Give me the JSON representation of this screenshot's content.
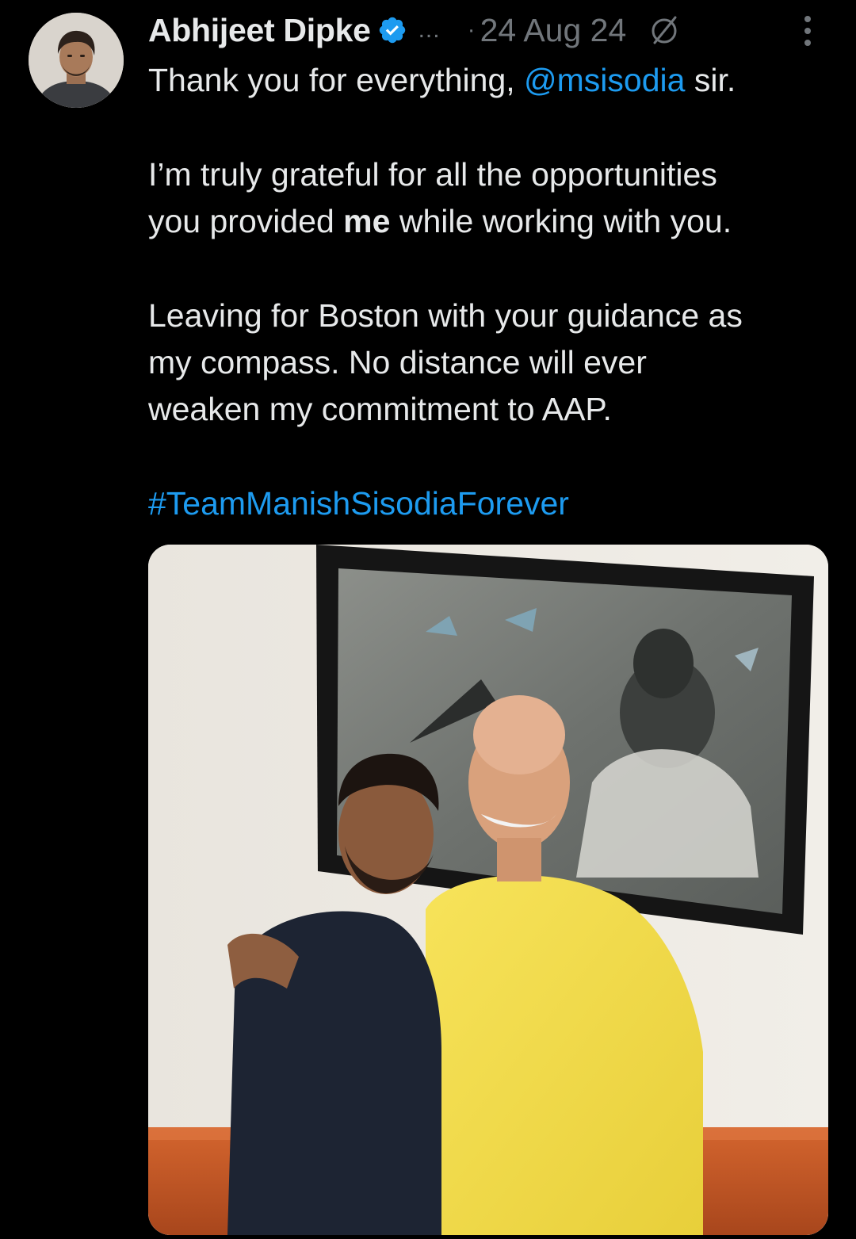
{
  "tweet": {
    "author": {
      "name": "Abhijeet Dipke",
      "handle_truncated": "...",
      "verified": true,
      "avatar_icon": "profile-avatar"
    },
    "separator": "·",
    "timestamp": "24 Aug 24",
    "text": {
      "line1_prefix": "Thank you for everything, ",
      "line1_mention": "@msisodia",
      "line1_suffix": " sir.",
      "line2": "I’m truly grateful for all the opportunities",
      "line3_prefix": "you provided ",
      "line3_bold": "me",
      "line3_suffix": " while working with you.",
      "line4": "Leaving for Boston with your guidance as",
      "line5": "my compass. No distance will ever",
      "line6": "weaken my commitment to AAP.",
      "hashtag": "#TeamManishSisodiaForever"
    },
    "icons": {
      "verified": "verified-badge-icon",
      "edited": "edited-icon",
      "more": "more-options-icon"
    },
    "colors": {
      "background": "#000000",
      "text": "#e7e9ea",
      "secondary": "#71767b",
      "link": "#1d9bf0"
    }
  }
}
